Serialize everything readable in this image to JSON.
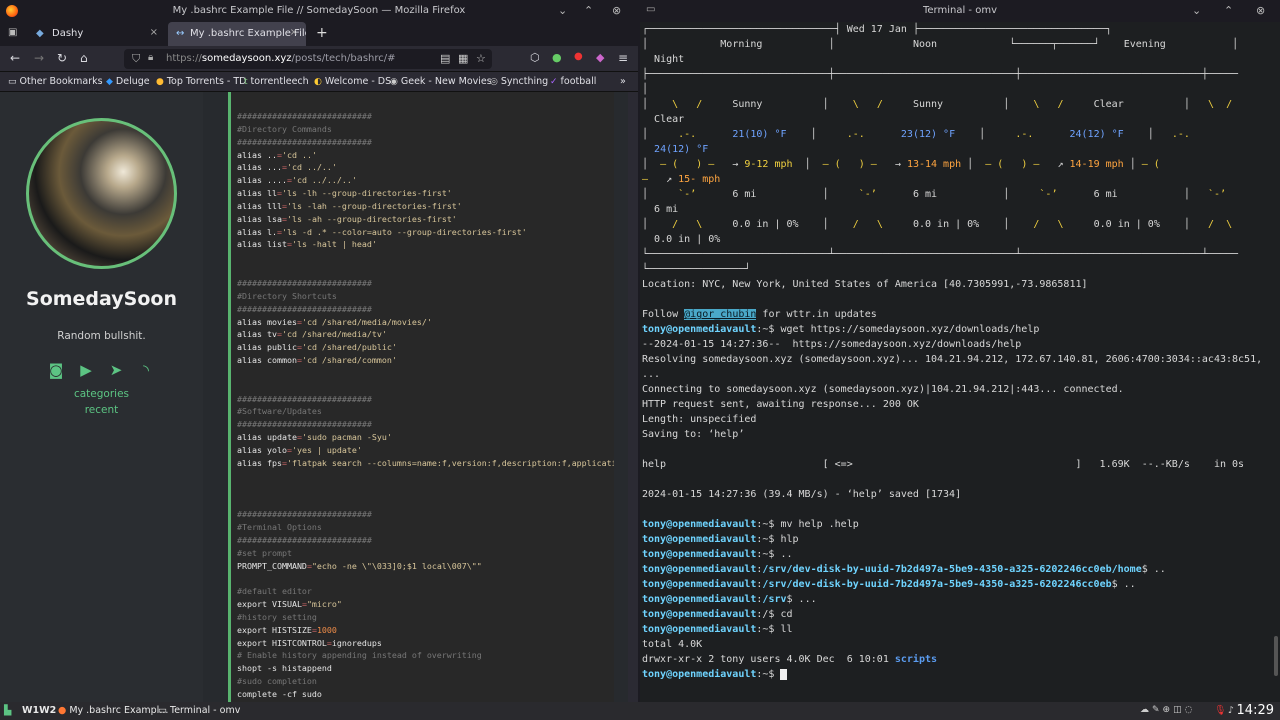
{
  "firefox": {
    "window_title": "My .bashrc Example File // SomedaySoon — Mozilla Firefox",
    "tabs": [
      {
        "label": "Dashy",
        "close": "×"
      },
      {
        "label": "My .bashrc Example File //",
        "close": "×"
      }
    ],
    "new_tab": "+",
    "url": {
      "scheme": "https://",
      "host": "somedaysoon.xyz",
      "path": "/posts/tech/bashrc/#"
    },
    "bookmarks": [
      "Other Bookmarks",
      "Deluge",
      "Top Torrents - TD",
      "torrentleech",
      "Welcome - DS",
      "Geek - New Movies",
      "Syncthing",
      "football"
    ],
    "overflow": "»"
  },
  "sidebar": {
    "site_name": "SomedaySoon",
    "description": "Random bullshit.",
    "nav": [
      "categories",
      "recent"
    ]
  },
  "terminal": {
    "window_title": "Terminal - omv",
    "weather": {
      "date": "Wed 17 Jan",
      "periods": [
        "Morning",
        "Noon",
        "Evening",
        "Night"
      ],
      "conditions": [
        "Sunny",
        "Sunny",
        "Clear",
        "Clear"
      ],
      "temps": [
        "21(10) °F",
        "23(12) °F",
        "24(12) °F",
        "24(12) °F"
      ],
      "wind": [
        "9-12 mph",
        "13-14 mph",
        "14-19 mph",
        "15- mph"
      ],
      "visibility": [
        "6 mi",
        "6 mi",
        "6 mi",
        "6 mi"
      ],
      "precip": [
        "0.0 in | 0%",
        "0.0 in | 0%",
        "0.0 in | 0%",
        "0.0 in | 0%"
      ]
    },
    "location": "Location: NYC, New York, United States of America [40.7305991,-73.9865811]",
    "follow": {
      "prefix": "Follow ",
      "handle": "@igor_chubin",
      "suffix": " for wttr.in updates"
    }
  },
  "taskbar": {
    "workspaces": "W1W2",
    "tasks": [
      "My .bashrc Exampl...",
      "Terminal - omv"
    ],
    "clock": "14:29"
  }
}
